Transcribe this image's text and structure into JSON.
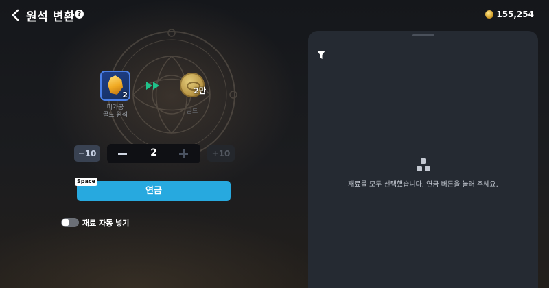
{
  "header": {
    "title": "원석 변환",
    "help_label": "?",
    "currency_value": "155,254",
    "currency_icon": "gold-coin-icon"
  },
  "conversion": {
    "source": {
      "name_line1": "미가공",
      "name_line2": "골드 원석",
      "quantity": "2",
      "icon": "gold-ore-icon"
    },
    "target": {
      "name": "골드",
      "quantity": "2만",
      "icon": "gold-coin-icon"
    },
    "arrow_icon": "fast-forward-icon",
    "arrow_color": "#1fc28a"
  },
  "stepper": {
    "minus10_label": "−10",
    "plus10_label": "+10",
    "value": "2"
  },
  "action": {
    "shortcut": "Space",
    "button_label": "연금",
    "button_color": "#27a9df"
  },
  "auto_fill": {
    "label": "재료 자동 넣기",
    "enabled": false
  },
  "materials_panel": {
    "filter_icon": "filter-icon",
    "empty_icon": "stack-icon",
    "empty_message": "재료를 모두 선택했습니다. 연금 버튼을 눌러 주세요."
  }
}
